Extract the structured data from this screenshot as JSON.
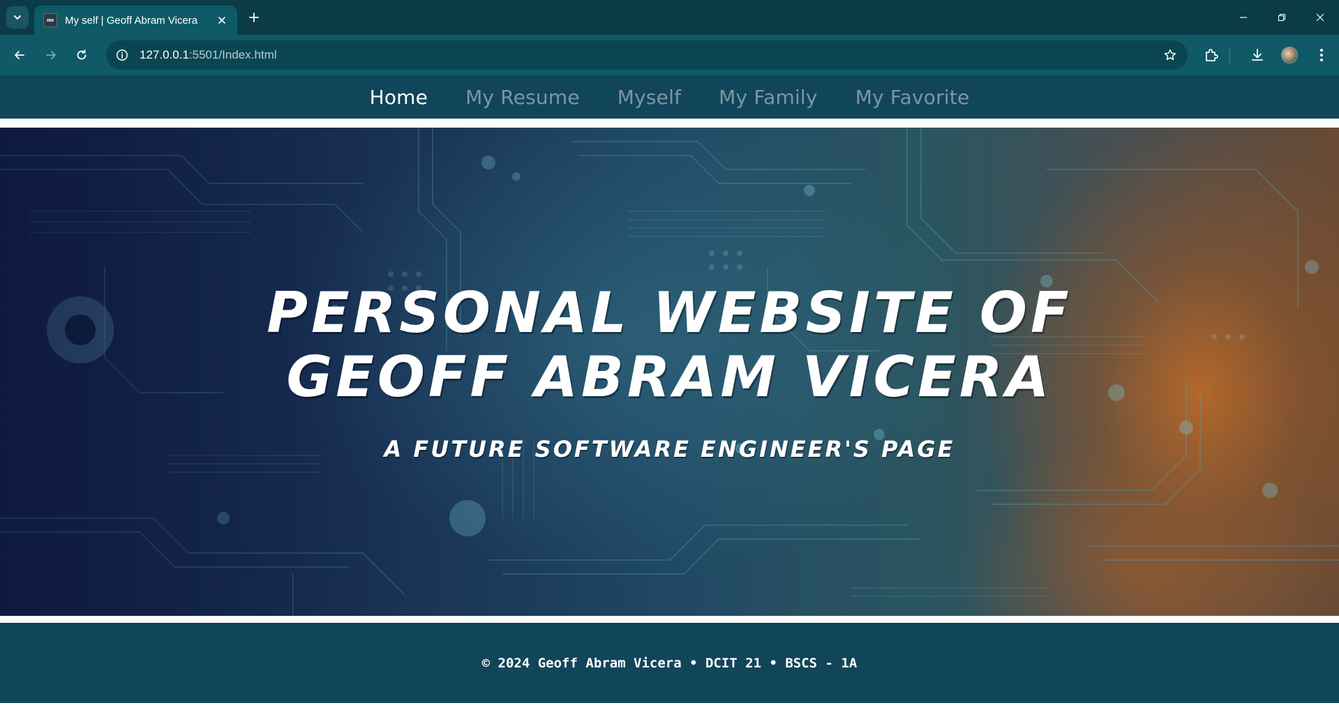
{
  "browser": {
    "tab_title": "My self | Geoff Abram Vicera",
    "url_host": "127.0.0.1",
    "url_rest": ":5501/Index.html"
  },
  "site": {
    "nav": [
      {
        "label": "Home",
        "active": true
      },
      {
        "label": "My Resume",
        "active": false
      },
      {
        "label": "Myself",
        "active": false
      },
      {
        "label": "My Family",
        "active": false
      },
      {
        "label": "My Favorite",
        "active": false
      }
    ],
    "hero": {
      "title_line1": "Personal Website of",
      "title_line2": "Geoff Abram Vicera",
      "subtitle": "A Future Software Engineer's Page"
    },
    "footer": "© 2024 Geoff Abram Vicera • DCIT 21 • BSCS - 1A"
  },
  "colors": {
    "chrome_dark": "#0b3b47",
    "chrome_toolbar": "#0f5a66",
    "site_nav_bg": "#11455a",
    "nav_inactive": "#7d96a2",
    "nav_active": "#ffffff"
  }
}
